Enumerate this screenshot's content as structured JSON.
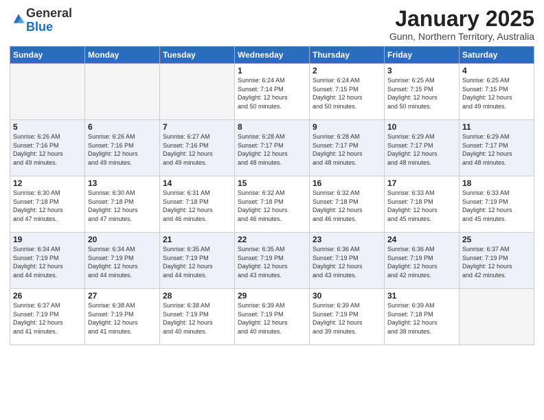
{
  "logo": {
    "general": "General",
    "blue": "Blue"
  },
  "title": "January 2025",
  "location": "Gunn, Northern Territory, Australia",
  "days_of_week": [
    "Sunday",
    "Monday",
    "Tuesday",
    "Wednesday",
    "Thursday",
    "Friday",
    "Saturday"
  ],
  "weeks": [
    [
      {
        "day": "",
        "info": ""
      },
      {
        "day": "",
        "info": ""
      },
      {
        "day": "",
        "info": ""
      },
      {
        "day": "1",
        "info": "Sunrise: 6:24 AM\nSunset: 7:14 PM\nDaylight: 12 hours\nand 50 minutes."
      },
      {
        "day": "2",
        "info": "Sunrise: 6:24 AM\nSunset: 7:15 PM\nDaylight: 12 hours\nand 50 minutes."
      },
      {
        "day": "3",
        "info": "Sunrise: 6:25 AM\nSunset: 7:15 PM\nDaylight: 12 hours\nand 50 minutes."
      },
      {
        "day": "4",
        "info": "Sunrise: 6:25 AM\nSunset: 7:15 PM\nDaylight: 12 hours\nand 49 minutes."
      }
    ],
    [
      {
        "day": "5",
        "info": "Sunrise: 6:26 AM\nSunset: 7:16 PM\nDaylight: 12 hours\nand 49 minutes."
      },
      {
        "day": "6",
        "info": "Sunrise: 6:26 AM\nSunset: 7:16 PM\nDaylight: 12 hours\nand 49 minutes."
      },
      {
        "day": "7",
        "info": "Sunrise: 6:27 AM\nSunset: 7:16 PM\nDaylight: 12 hours\nand 49 minutes."
      },
      {
        "day": "8",
        "info": "Sunrise: 6:28 AM\nSunset: 7:17 PM\nDaylight: 12 hours\nand 48 minutes."
      },
      {
        "day": "9",
        "info": "Sunrise: 6:28 AM\nSunset: 7:17 PM\nDaylight: 12 hours\nand 48 minutes."
      },
      {
        "day": "10",
        "info": "Sunrise: 6:29 AM\nSunset: 7:17 PM\nDaylight: 12 hours\nand 48 minutes."
      },
      {
        "day": "11",
        "info": "Sunrise: 6:29 AM\nSunset: 7:17 PM\nDaylight: 12 hours\nand 48 minutes."
      }
    ],
    [
      {
        "day": "12",
        "info": "Sunrise: 6:30 AM\nSunset: 7:18 PM\nDaylight: 12 hours\nand 47 minutes."
      },
      {
        "day": "13",
        "info": "Sunrise: 6:30 AM\nSunset: 7:18 PM\nDaylight: 12 hours\nand 47 minutes."
      },
      {
        "day": "14",
        "info": "Sunrise: 6:31 AM\nSunset: 7:18 PM\nDaylight: 12 hours\nand 46 minutes."
      },
      {
        "day": "15",
        "info": "Sunrise: 6:32 AM\nSunset: 7:18 PM\nDaylight: 12 hours\nand 46 minutes."
      },
      {
        "day": "16",
        "info": "Sunrise: 6:32 AM\nSunset: 7:18 PM\nDaylight: 12 hours\nand 46 minutes."
      },
      {
        "day": "17",
        "info": "Sunrise: 6:33 AM\nSunset: 7:18 PM\nDaylight: 12 hours\nand 45 minutes."
      },
      {
        "day": "18",
        "info": "Sunrise: 6:33 AM\nSunset: 7:19 PM\nDaylight: 12 hours\nand 45 minutes."
      }
    ],
    [
      {
        "day": "19",
        "info": "Sunrise: 6:34 AM\nSunset: 7:19 PM\nDaylight: 12 hours\nand 44 minutes."
      },
      {
        "day": "20",
        "info": "Sunrise: 6:34 AM\nSunset: 7:19 PM\nDaylight: 12 hours\nand 44 minutes."
      },
      {
        "day": "21",
        "info": "Sunrise: 6:35 AM\nSunset: 7:19 PM\nDaylight: 12 hours\nand 44 minutes."
      },
      {
        "day": "22",
        "info": "Sunrise: 6:35 AM\nSunset: 7:19 PM\nDaylight: 12 hours\nand 43 minutes."
      },
      {
        "day": "23",
        "info": "Sunrise: 6:36 AM\nSunset: 7:19 PM\nDaylight: 12 hours\nand 43 minutes."
      },
      {
        "day": "24",
        "info": "Sunrise: 6:36 AM\nSunset: 7:19 PM\nDaylight: 12 hours\nand 42 minutes."
      },
      {
        "day": "25",
        "info": "Sunrise: 6:37 AM\nSunset: 7:19 PM\nDaylight: 12 hours\nand 42 minutes."
      }
    ],
    [
      {
        "day": "26",
        "info": "Sunrise: 6:37 AM\nSunset: 7:19 PM\nDaylight: 12 hours\nand 41 minutes."
      },
      {
        "day": "27",
        "info": "Sunrise: 6:38 AM\nSunset: 7:19 PM\nDaylight: 12 hours\nand 41 minutes."
      },
      {
        "day": "28",
        "info": "Sunrise: 6:38 AM\nSunset: 7:19 PM\nDaylight: 12 hours\nand 40 minutes."
      },
      {
        "day": "29",
        "info": "Sunrise: 6:39 AM\nSunset: 7:19 PM\nDaylight: 12 hours\nand 40 minutes."
      },
      {
        "day": "30",
        "info": "Sunrise: 6:39 AM\nSunset: 7:19 PM\nDaylight: 12 hours\nand 39 minutes."
      },
      {
        "day": "31",
        "info": "Sunrise: 6:39 AM\nSunset: 7:18 PM\nDaylight: 12 hours\nand 38 minutes."
      },
      {
        "day": "",
        "info": ""
      }
    ]
  ]
}
